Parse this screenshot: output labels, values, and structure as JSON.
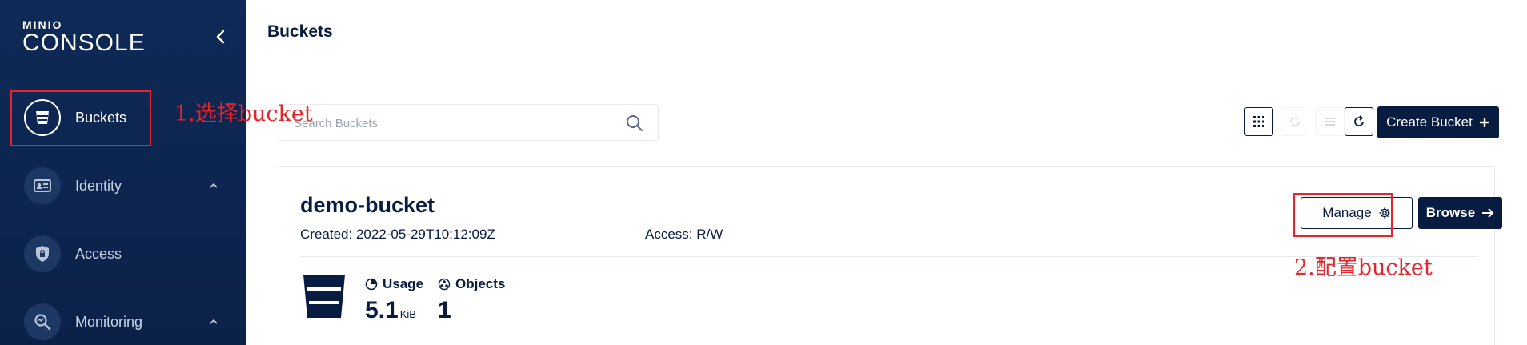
{
  "app": {
    "logo_small": "MINIO",
    "logo_big": "CONSOLE"
  },
  "sidebar": {
    "items": [
      {
        "label": "Buckets",
        "icon": "bucket-icon",
        "active": true
      },
      {
        "label": "Identity",
        "icon": "id-card-icon",
        "expandable": true
      },
      {
        "label": "Access",
        "icon": "shield-lock-icon"
      },
      {
        "label": "Monitoring",
        "icon": "monitor-search-icon",
        "expandable": true
      }
    ]
  },
  "header": {
    "title": "Buckets"
  },
  "search": {
    "placeholder": "Search Buckets",
    "value": ""
  },
  "toolbar": {
    "create_label": "Create Bucket"
  },
  "bucket": {
    "name": "demo-bucket",
    "created": "Created: 2022-05-29T10:12:09Z",
    "access": "Access: R/W",
    "manage_label": "Manage",
    "browse_label": "Browse",
    "usage_label": "Usage",
    "usage_value": "5.1",
    "usage_unit": "KiB",
    "objects_label": "Objects",
    "objects_value": "1"
  },
  "annotations": {
    "step1": "1.选择bucket",
    "step2": "2.配置bucket"
  },
  "colors": {
    "sidebar_bg": "#0f2a57",
    "primary": "#081c42",
    "annotation_red": "#e8232a"
  }
}
